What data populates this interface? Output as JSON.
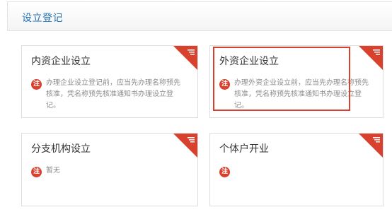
{
  "header": {
    "title": "设立登记"
  },
  "cards": [
    {
      "title": "内资企业设立",
      "badge": "注",
      "note": "办理企业设立登记前，应当先办理名称预先核准，凭名称预先核准通知书办理设立登记。"
    },
    {
      "title": "外资企业设立",
      "badge": "注",
      "note": "办理外资企业设立前，应当先办理名称预先核准，凭名称预先核准通知书办理设立登记。"
    },
    {
      "title": "分支机构设立",
      "badge": "注",
      "note": "暂无"
    },
    {
      "title": "个体户开业",
      "badge": "注",
      "note": ""
    }
  ],
  "colors": {
    "accent": "#d9412f",
    "title_blue": "#1f6fb5",
    "note_gray": "#8c8c8c"
  },
  "icons": {
    "corner": "menu-lines-icon",
    "badge": "note-badge-icon"
  }
}
